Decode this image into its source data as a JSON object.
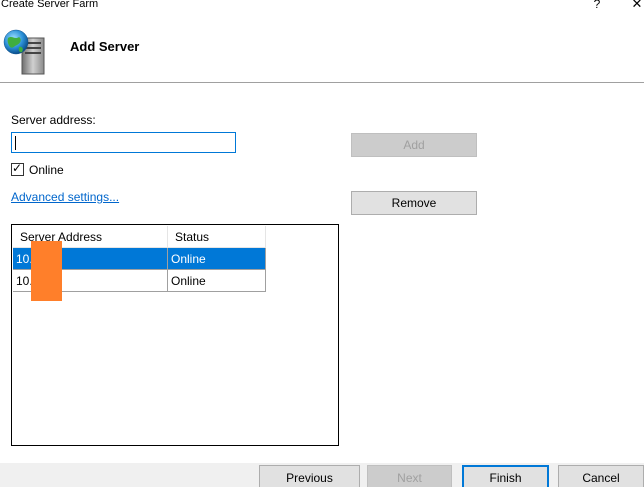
{
  "window": {
    "title": "Create Server Farm",
    "help_glyph": "?",
    "close_glyph": "✕"
  },
  "header": {
    "title": "Add Server",
    "icon": "server-globe-icon"
  },
  "form": {
    "server_address_label": "Server address:",
    "server_address_value": "",
    "online_checked": true,
    "online_label": "Online",
    "advanced_link": "Advanced settings..."
  },
  "buttons": {
    "add": "Add",
    "remove": "Remove",
    "previous": "Previous",
    "next": "Next",
    "finish": "Finish",
    "cancel": "Cancel"
  },
  "server_list": {
    "columns": [
      "Server Address",
      "Status"
    ],
    "rows": [
      {
        "address": "10.",
        "status": "Online",
        "selected": true
      },
      {
        "address": "10.",
        "status": "Online",
        "selected": false
      }
    ]
  },
  "colors": {
    "selection": "#0078d7",
    "link": "#0066cc",
    "redaction": "#ff7f2a"
  }
}
